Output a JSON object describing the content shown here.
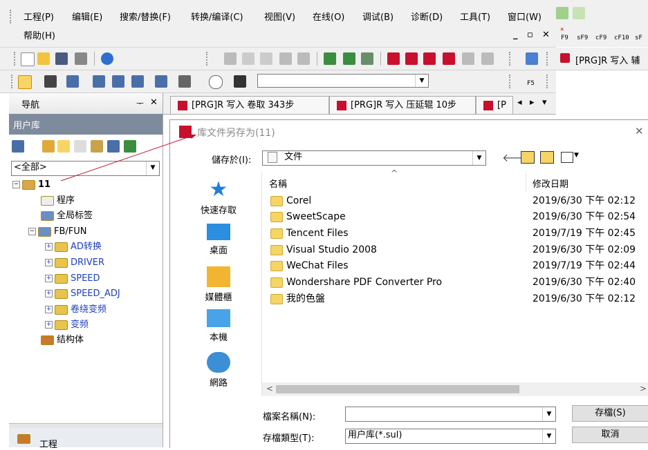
{
  "menubar": {
    "items": [
      "工程(P)",
      "编辑(E)",
      "搜索/替换(F)",
      "转换/编译(C)",
      "视图(V)",
      "在线(O)",
      "调试(B)",
      "诊断(D)",
      "工具(T)",
      "窗口(W)"
    ],
    "help": "帮助(H)",
    "window_controls": [
      "_",
      "▫",
      "✕"
    ]
  },
  "fkeys": [
    "F9",
    "sF9",
    "cF9",
    "cF10",
    "sF"
  ],
  "toolbar3": {
    "fkey": "F5"
  },
  "right_tab": "[PRG]R 写入 辅",
  "nav": {
    "title": "导航",
    "pin": "ᅮ",
    "close": "✕",
    "section": "用户库",
    "filter": "<全部>",
    "tree": {
      "root": "11",
      "program": "程序",
      "global_label": "全局标签",
      "fbfun": "FB/FUN",
      "items": [
        "AD转换",
        "DRIVER",
        "SPEED",
        "SPEED_ADJ",
        "卷绕变频",
        "变频"
      ],
      "struct": "结构体"
    },
    "bottom_item": "工程"
  },
  "tabs": [
    "[PRG]R 写入 卷取 343步",
    "[PRG]R 写入 压延辊 10步",
    "[P"
  ],
  "tab_nav": [
    "◂",
    "▸",
    "▾"
  ],
  "dialog": {
    "title": "库文件另存为(11)",
    "close": "✕",
    "save_in_label": "儲存於(I):",
    "save_in_value": "文件",
    "places": [
      "快速存取",
      "桌面",
      "媒體櫃",
      "本機",
      "網路"
    ],
    "columns": {
      "name": "名稱",
      "modified": "修改日期"
    },
    "files": [
      {
        "name": "Corel",
        "date": "2019/6/30 下午 02:12"
      },
      {
        "name": "SweetScape",
        "date": "2019/6/30 下午 02:54"
      },
      {
        "name": "Tencent Files",
        "date": "2019/7/19 下午 02:45"
      },
      {
        "name": "Visual Studio 2008",
        "date": "2019/6/30 下午 02:09"
      },
      {
        "name": "WeChat Files",
        "date": "2019/7/19 下午 02:44"
      },
      {
        "name": "Wondershare PDF Converter Pro",
        "date": "2019/6/30 下午 02:40"
      },
      {
        "name": "我的色盤",
        "date": "2019/6/30 下午 02:12"
      }
    ],
    "filename_label": "檔案名稱(N):",
    "filename_value": "",
    "filetype_label": "存檔類型(T):",
    "filetype_value": "用户库(*.sul)",
    "save_button": "存檔(S)",
    "cancel_button": "取消"
  },
  "colors": {
    "accent_red": "#c8102e",
    "nav_header": "#7e8b9c",
    "tree_blue": "#1f3fbf",
    "folder": "#f6d465"
  }
}
